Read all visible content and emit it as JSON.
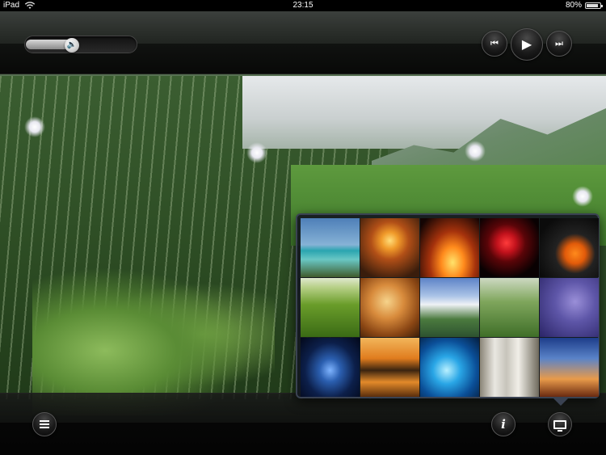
{
  "status_bar": {
    "carrier": "iPad",
    "time": "23:15",
    "battery_percent_label": "80%",
    "battery_level": 0.8,
    "wifi_icon": "wifi-icon"
  },
  "player": {
    "volume_level": 0.42,
    "volume_icon": "speaker-icon",
    "prev_icon": "previous-track-icon",
    "play_icon": "play-icon",
    "next_icon": "next-track-icon"
  },
  "toolbar": {
    "playlist_icon": "list-icon",
    "info_icon": "info-icon",
    "info_glyph": "i",
    "screen_icon": "display-icon"
  },
  "scene_picker": {
    "thumbnails": [
      {
        "id": "beach"
      },
      {
        "id": "sunset-clouds"
      },
      {
        "id": "fireplace"
      },
      {
        "id": "fireworks"
      },
      {
        "id": "clownfish"
      },
      {
        "id": "grass"
      },
      {
        "id": "autumn-tree"
      },
      {
        "id": "mountain-lake"
      },
      {
        "id": "forest-flowers"
      },
      {
        "id": "rain"
      },
      {
        "id": "stars"
      },
      {
        "id": "lake-sunset"
      },
      {
        "id": "water-splash"
      },
      {
        "id": "waterfall"
      },
      {
        "id": "windmills"
      }
    ]
  }
}
